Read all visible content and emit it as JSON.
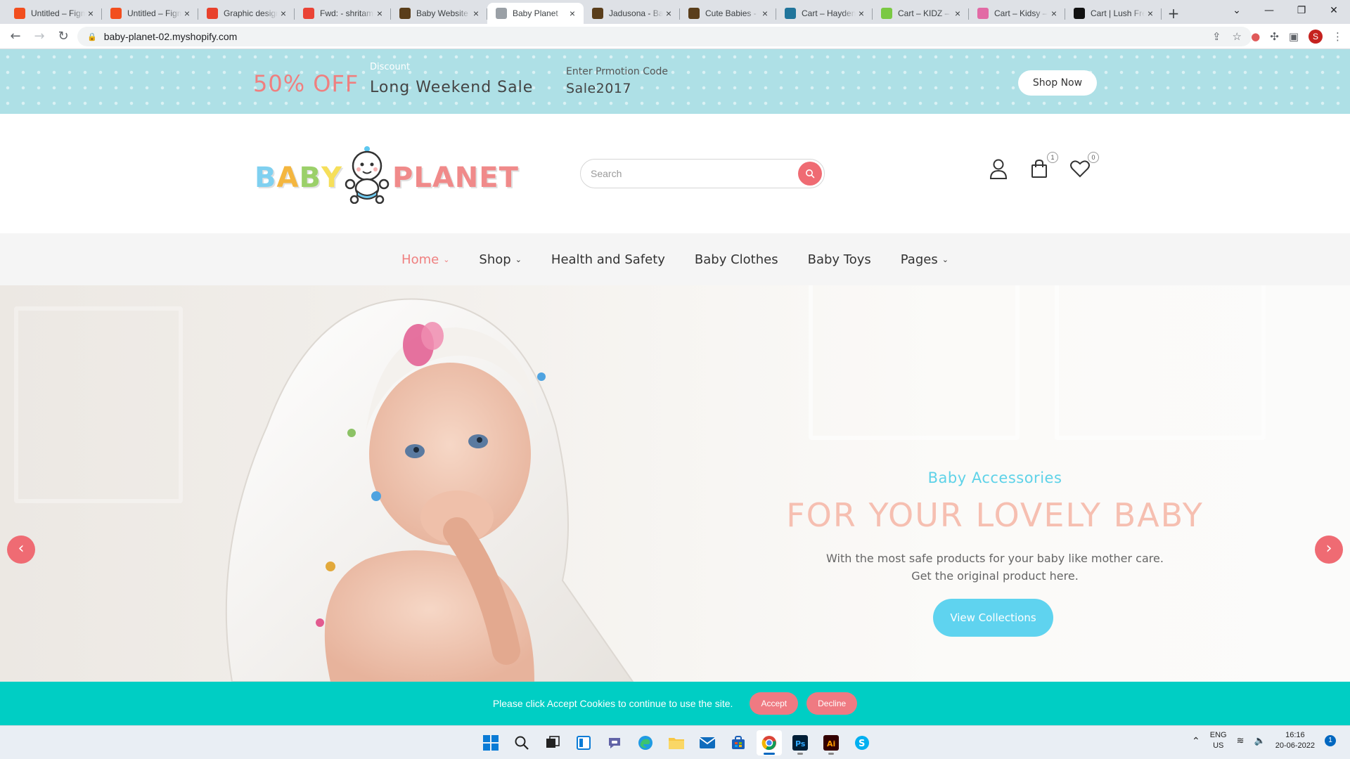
{
  "browser": {
    "tabs": [
      {
        "title": "Untitled – Figma",
        "icon": "figma-icon",
        "color": "#f24e1e"
      },
      {
        "title": "Untitled – Figma",
        "icon": "figma-icon",
        "color": "#f24e1e"
      },
      {
        "title": "Graphic designer",
        "icon": "99designs-icon",
        "color": "#e8412c"
      },
      {
        "title": "Fwd: - shritama",
        "icon": "gmail-icon",
        "color": "#ea4335"
      },
      {
        "title": "Baby Website",
        "icon": "page-icon",
        "color": "#5a3e1b"
      },
      {
        "title": "Baby Planet",
        "icon": "shopify-icon",
        "color": "#9aa0a6"
      },
      {
        "title": "Jadusona - Baby",
        "icon": "page-icon",
        "color": "#5a3e1b"
      },
      {
        "title": "Cute Babies -",
        "icon": "page-icon",
        "color": "#5a3e1b"
      },
      {
        "title": "Cart – Hayden",
        "icon": "wordpress-icon",
        "color": "#21759b"
      },
      {
        "title": "Cart – KIDZ –",
        "icon": "kidz-icon",
        "color": "#7ac943"
      },
      {
        "title": "Cart – Kidsy –",
        "icon": "kidsy-icon",
        "color": "#e26aa5"
      },
      {
        "title": "Cart | Lush Fre",
        "icon": "lush-icon",
        "color": "#111111"
      }
    ],
    "active_tab": 5,
    "url": "baby-planet-02.myshopify.com",
    "profile_initial": "S"
  },
  "promo": {
    "off_text": "50% OFF",
    "discount_label": "Discount",
    "sale_title": "Long Weekend Sale",
    "code_label": "Enter Prmotion Code",
    "code": "Sale2017",
    "shop_now": "Shop Now"
  },
  "logo": {
    "word1": "BABY",
    "word2": "PLANET"
  },
  "search": {
    "placeholder": "Search"
  },
  "header_icons": {
    "cart_count": "1",
    "wishlist_count": "0"
  },
  "nav": [
    {
      "label": "Home",
      "dropdown": true,
      "active": true
    },
    {
      "label": "Shop",
      "dropdown": true
    },
    {
      "label": "Health and Safety"
    },
    {
      "label": "Baby Clothes"
    },
    {
      "label": "Baby Toys"
    },
    {
      "label": "Pages",
      "dropdown": true
    }
  ],
  "hero": {
    "subtitle": "Baby Accessories",
    "headline": "FOR YOUR LOVELY BABY",
    "description": "With the most safe products for your baby like mother care. Get the original product here.",
    "cta": "View Collections"
  },
  "cookie": {
    "message": "Please click Accept Cookies to continue to use the site.",
    "accept": "Accept",
    "decline": "Decline"
  },
  "taskbar": {
    "language": "ENG",
    "region": "US",
    "time": "16:16",
    "date": "20-06-2022",
    "notifications": "1"
  },
  "colors": {
    "accent_pink": "#ef6b73",
    "accent_cyan": "#5fd3ef",
    "cookie_bg": "#00cec4",
    "promo_bg": "#aee0e6"
  }
}
